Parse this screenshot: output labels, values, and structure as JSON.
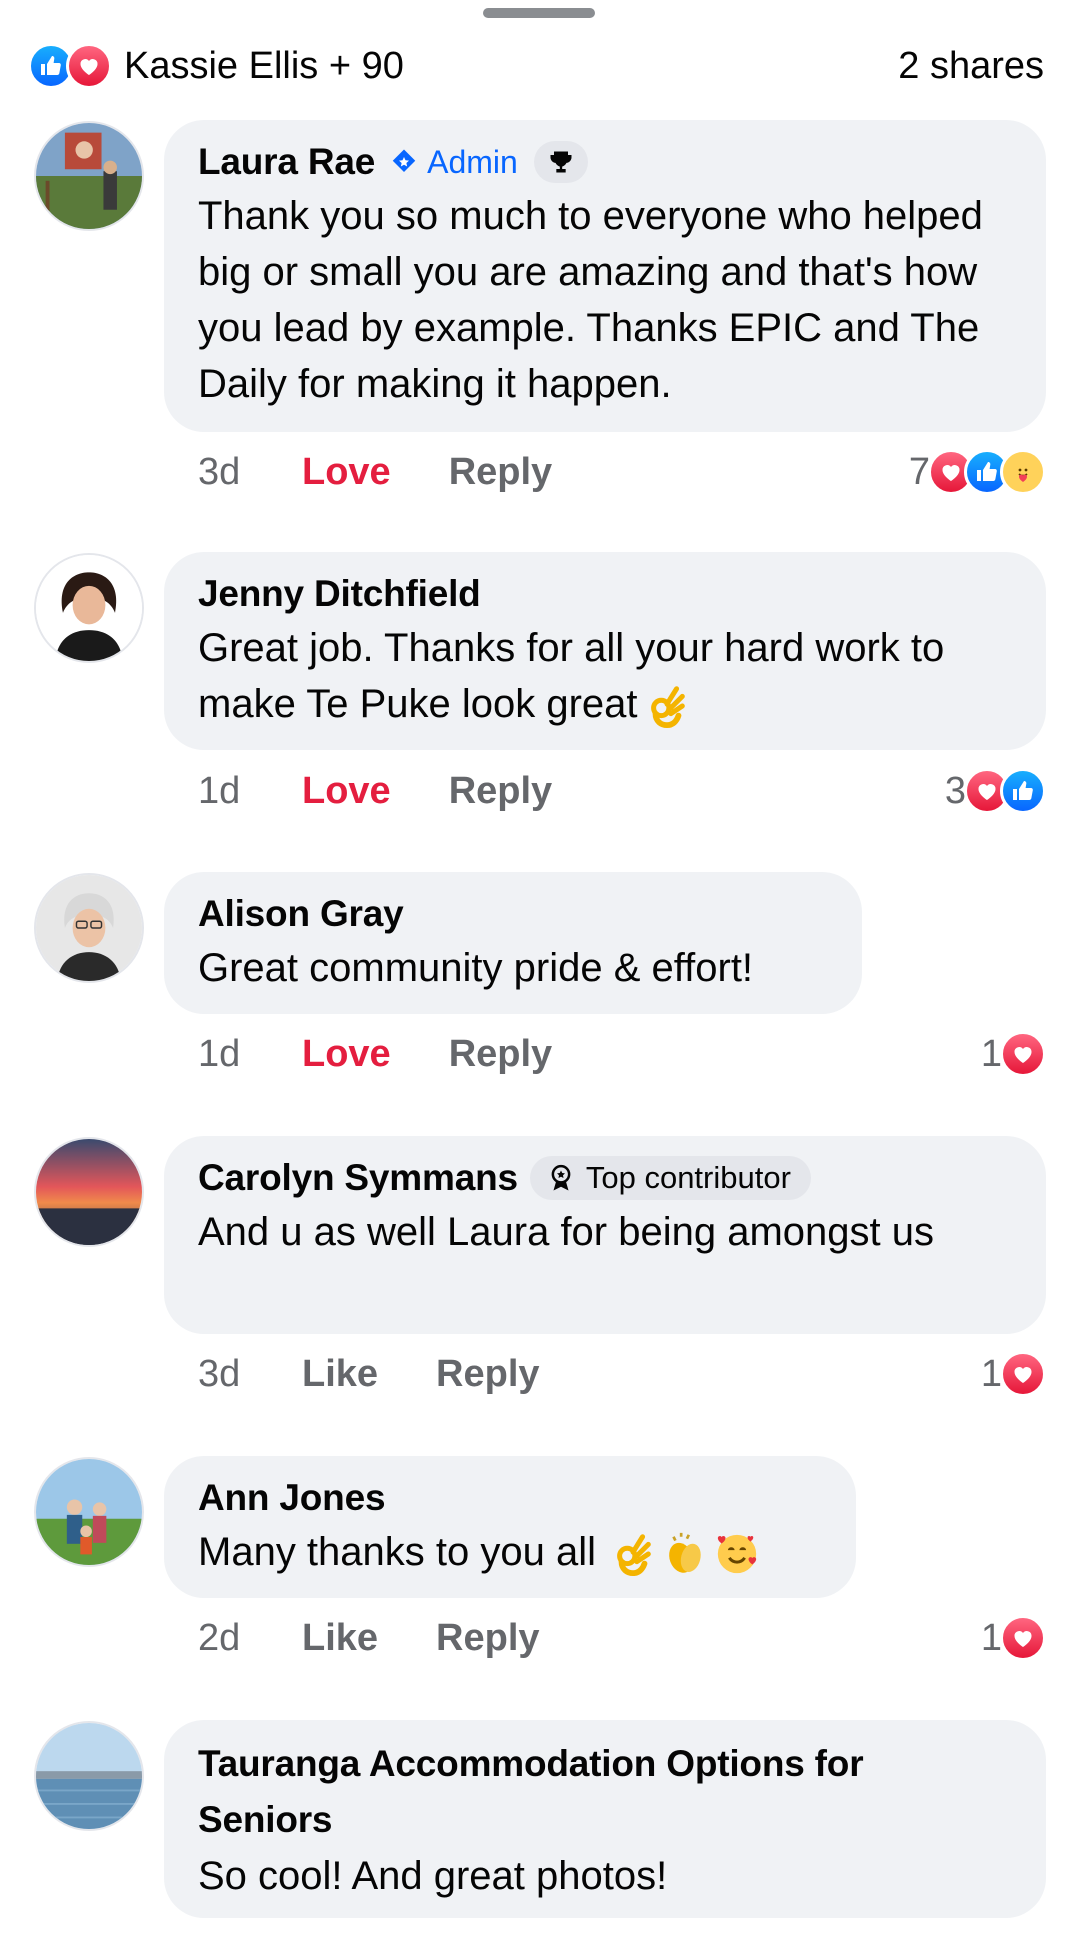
{
  "summary": {
    "names": "Kassie Ellis + 90",
    "shares": "2 shares"
  },
  "comments": [
    {
      "author": "Laura Rae",
      "badge": "Admin",
      "text": "Thank you so much to everyone who helped big or small you are amazing and that's how you lead by example. Thanks EPIC and The Daily for making it happen.",
      "time": "3d",
      "action": "Love",
      "reply": "Reply",
      "reaction_count": "7",
      "reactions": [
        "love",
        "like",
        "care"
      ]
    },
    {
      "author": "Jenny Ditchfield",
      "text": "Great job. Thanks for all your hard work to make Te Puke look great",
      "time": "1d",
      "action": "Love",
      "reply": "Reply",
      "reaction_count": "3",
      "reactions": [
        "love",
        "like"
      ]
    },
    {
      "author": "Alison Gray",
      "text": "Great community pride & effort!",
      "time": "1d",
      "action": "Love",
      "reply": "Reply",
      "reaction_count": "1",
      "reactions": [
        "love"
      ]
    },
    {
      "author": "Carolyn Symmans",
      "badge": "Top contributor",
      "text": "And u as well Laura for being amongst us",
      "time": "3d",
      "action": "Like",
      "reply": "Reply",
      "reaction_count": "1",
      "reactions": [
        "love"
      ]
    },
    {
      "author": "Ann Jones",
      "text": "Many thanks to you all",
      "time": "2d",
      "action": "Like",
      "reply": "Reply",
      "reaction_count": "1",
      "reactions": [
        "love"
      ]
    },
    {
      "author": "Tauranga Accommodation Options for Seniors",
      "text": "So cool! And great photos!"
    }
  ],
  "colors": {
    "like_blue": "#0866ff",
    "love_red": "#e41e3f",
    "bubble_gray": "#f0f2f5",
    "meta_gray": "#65676b"
  }
}
